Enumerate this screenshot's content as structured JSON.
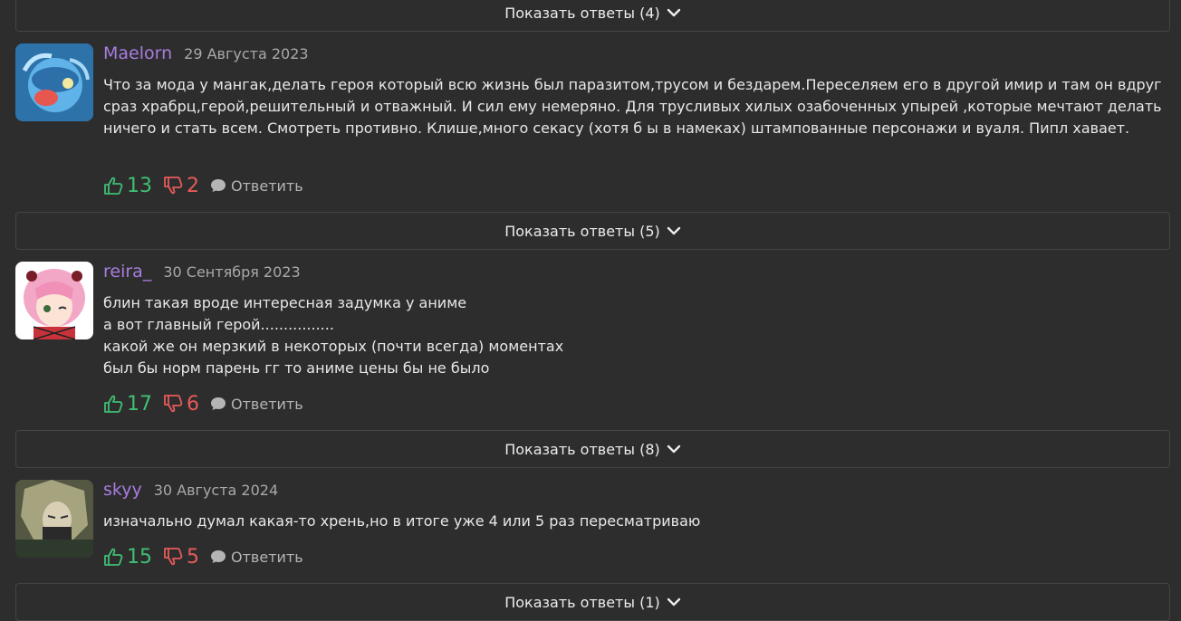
{
  "colors": {
    "background": "#2d2d2d",
    "username": "#a77de0",
    "like": "#3fbf73",
    "dislike": "#e85a5a"
  },
  "replies_buttons": [
    {
      "label": "Показать ответы (4)"
    },
    {
      "label": "Показать ответы (5)"
    },
    {
      "label": "Показать ответы (8)"
    },
    {
      "label": "Показать ответы (1)"
    }
  ],
  "comments": [
    {
      "username": "Maelorn",
      "date": "29 Августа 2023",
      "text": "Что за мода у мангак,делать героя который всю жизнь был паразитом,трусом и бездарем.Переселяем его в другой имир и там он вдруг сраз храбрц,герой,решительный и отважный. И сил ему немеряно. Для трусливых хилых озабоченных  упырей ,которые мечтают делать ничего и стать всем. Смотреть противно. Клише,много секасу (хотя б ы в намеках) штампованные персонажи и вуаля. Пипл хавает.",
      "likes": "13",
      "dislikes": "2",
      "reply_label": "Ответить"
    },
    {
      "username": "reira_",
      "date": "30 Сентября 2023",
      "text": "блин такая вроде интересная задумка у аниме\nа вот главный герой................\nкакой же он мерзкий в некоторых (почти всегда) моментах\nбыл бы норм парень гг то аниме цены бы не было",
      "likes": "17",
      "dislikes": "6",
      "reply_label": "Ответить"
    },
    {
      "username": "skyy",
      "date": "30 Августа 2024",
      "text": "изначально думал какая-то хрень,но в итоге уже 4 или 5 раз пересматриваю",
      "likes": "15",
      "dislikes": "5",
      "reply_label": "Ответить"
    }
  ],
  "icons": {
    "like": "thumb-up-icon",
    "dislike": "thumb-down-icon",
    "reply": "speech-bubble-icon",
    "expand": "chevron-down-icon"
  }
}
